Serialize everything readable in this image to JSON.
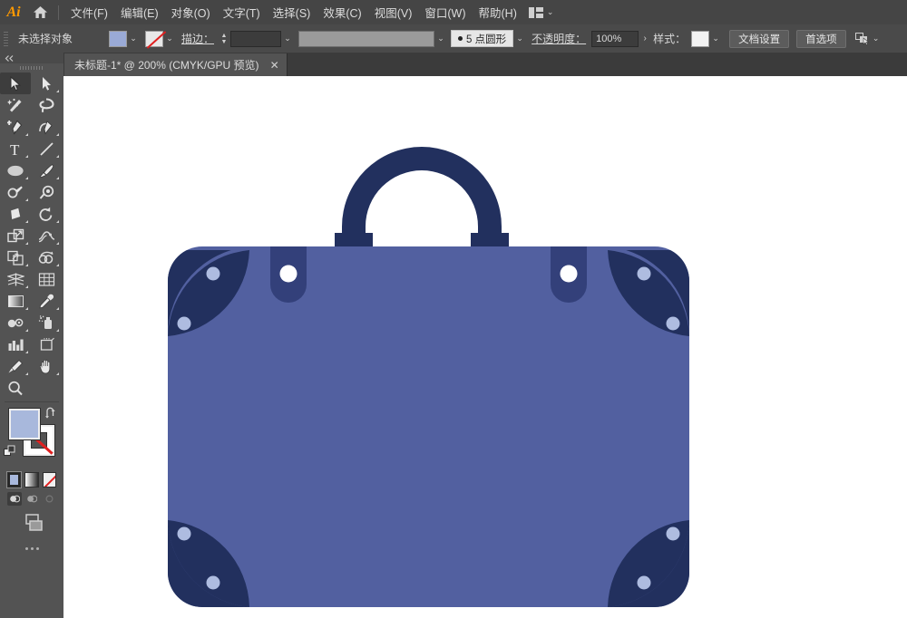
{
  "app": {
    "name": "Ai",
    "logo_color": "#ff9a00"
  },
  "menubar": {
    "home_icon": "home-icon",
    "items": [
      {
        "label": "文件(F)"
      },
      {
        "label": "编辑(E)"
      },
      {
        "label": "对象(O)"
      },
      {
        "label": "文字(T)"
      },
      {
        "label": "选择(S)"
      },
      {
        "label": "效果(C)"
      },
      {
        "label": "视图(V)"
      },
      {
        "label": "窗口(W)"
      },
      {
        "label": "帮助(H)"
      }
    ],
    "arrange_icon": "arrange-documents-icon",
    "arrange_caret": "⌄"
  },
  "controlbar": {
    "selection_status": "未选择对象",
    "fill_swatch_color": "#9aaad6",
    "fill_caret": "⌄",
    "stroke_swatch": "none",
    "stroke_caret": "⌄",
    "stroke_label": "描边：",
    "stroke_weight_value": "",
    "stroke_weight_caret": "⌄",
    "stroke_profile_value": "",
    "stroke_profile_caret": "⌄",
    "brush_label": "5 点圆形",
    "brush_caret": "⌄",
    "opacity_label": "不透明度：",
    "opacity_value": "100%",
    "opacity_arrow": "›",
    "style_label": "样式：",
    "style_swatch_caret": "⌄",
    "doc_setup_button": "文档设置",
    "preferences_button": "首选项",
    "dock_icon": "select-behind-icon",
    "dock_caret": "⌄"
  },
  "tabbar": {
    "tabs": [
      {
        "title": "未标题-1* @ 200% (CMYK/GPU 预览)",
        "close": "✕",
        "active": true
      }
    ]
  },
  "toolbar": {
    "collapse_icon": "double-chevron-left-icon",
    "grip": "panel-grip",
    "tools": [
      {
        "name": "selection-tool",
        "label": "选择工具",
        "active": true,
        "has_flyout": false
      },
      {
        "name": "direct-selection-tool",
        "label": "直接选择工具",
        "active": false,
        "has_flyout": true
      },
      {
        "name": "magic-wand-tool",
        "label": "魔棒工具",
        "active": false,
        "has_flyout": false
      },
      {
        "name": "lasso-tool",
        "label": "套索工具",
        "active": false,
        "has_flyout": false
      },
      {
        "name": "pen-tool",
        "label": "钢笔工具",
        "active": false,
        "has_flyout": true
      },
      {
        "name": "curvature-tool",
        "label": "曲率工具",
        "active": false,
        "has_flyout": true
      },
      {
        "name": "type-tool",
        "label": "文字工具",
        "active": false,
        "has_flyout": true
      },
      {
        "name": "line-segment-tool",
        "label": "直线段工具",
        "active": false,
        "has_flyout": true
      },
      {
        "name": "ellipse-tool",
        "label": "椭圆工具",
        "active": false,
        "has_flyout": true
      },
      {
        "name": "paintbrush-tool",
        "label": "画笔工具",
        "active": false,
        "has_flyout": true
      },
      {
        "name": "shaper-tool",
        "label": "Shaper 工具",
        "active": false,
        "has_flyout": true
      },
      {
        "name": "blob-brush-tool",
        "label": "斑点画笔工具",
        "active": false,
        "has_flyout": false
      },
      {
        "name": "eraser-tool",
        "label": "橡皮擦工具",
        "active": false,
        "has_flyout": true
      },
      {
        "name": "rotate-tool",
        "label": "旋转工具",
        "active": false,
        "has_flyout": true
      },
      {
        "name": "scale-tool",
        "label": "比例缩放工具",
        "active": false,
        "has_flyout": true
      },
      {
        "name": "width-tool",
        "label": "宽度工具",
        "active": false,
        "has_flyout": true
      },
      {
        "name": "free-transform-tool",
        "label": "自由变换工具",
        "active": false,
        "has_flyout": false
      },
      {
        "name": "shape-builder-tool",
        "label": "形状生成器工具",
        "active": false,
        "has_flyout": true
      },
      {
        "name": "perspective-grid-tool",
        "label": "透视网格工具",
        "active": false,
        "has_flyout": true
      },
      {
        "name": "mesh-tool",
        "label": "网格工具",
        "active": false,
        "has_flyout": false
      },
      {
        "name": "gradient-tool",
        "label": "渐变工具",
        "active": false,
        "has_flyout": false
      },
      {
        "name": "eyedropper-tool",
        "label": "吸管工具",
        "active": false,
        "has_flyout": true
      },
      {
        "name": "blend-tool",
        "label": "混合工具",
        "active": false,
        "has_flyout": false
      },
      {
        "name": "symbol-sprayer-tool",
        "label": "符号喷枪工具",
        "active": false,
        "has_flyout": true
      },
      {
        "name": "column-graph-tool",
        "label": "柱形图工具",
        "active": false,
        "has_flyout": true
      },
      {
        "name": "artboard-tool",
        "label": "画板工具",
        "active": false,
        "has_flyout": false
      },
      {
        "name": "slice-tool",
        "label": "切片工具",
        "active": false,
        "has_flyout": true
      },
      {
        "name": "hand-tool",
        "label": "抓手工具",
        "active": false,
        "has_flyout": true
      },
      {
        "name": "zoom-tool",
        "label": "缩放工具",
        "active": false,
        "has_flyout": false
      }
    ],
    "fill_color": "#a8b8dc",
    "stroke_color": "none",
    "swap_icon": "swap-fill-stroke-icon",
    "default_icon": "default-fill-stroke-icon",
    "color_modes": [
      {
        "name": "color-mode-button",
        "type": "color",
        "selected": true
      },
      {
        "name": "gradient-mode-button",
        "type": "gradient",
        "selected": false
      },
      {
        "name": "none-mode-button",
        "type": "none",
        "selected": false
      }
    ],
    "draw_modes": [
      {
        "name": "draw-normal-button",
        "selected": true
      },
      {
        "name": "draw-behind-button",
        "selected": false
      },
      {
        "name": "draw-inside-button",
        "selected": false
      }
    ],
    "screen_mode_icon": "change-screen-mode-icon",
    "more_tools_icon": "edit-toolbar-icon"
  },
  "artwork": {
    "title": "手提箱插图",
    "colors": {
      "body": "#5260a0",
      "dark_navy": "#22305e",
      "dot_light": "#aebce0",
      "buckle_white": "#ffffff",
      "canvas_background": "#ffffff"
    },
    "parts": [
      {
        "name": "suitcase-handle",
        "shape": "arch"
      },
      {
        "name": "suitcase-body",
        "shape": "rounded-rectangle"
      },
      {
        "name": "corner-top-left",
        "dots": 2
      },
      {
        "name": "corner-top-right",
        "dots": 2
      },
      {
        "name": "corner-bottom-left",
        "dots": 2
      },
      {
        "name": "corner-bottom-right",
        "dots": 2
      },
      {
        "name": "strap-left",
        "buckle": 1
      },
      {
        "name": "strap-right",
        "buckle": 1
      }
    ]
  }
}
